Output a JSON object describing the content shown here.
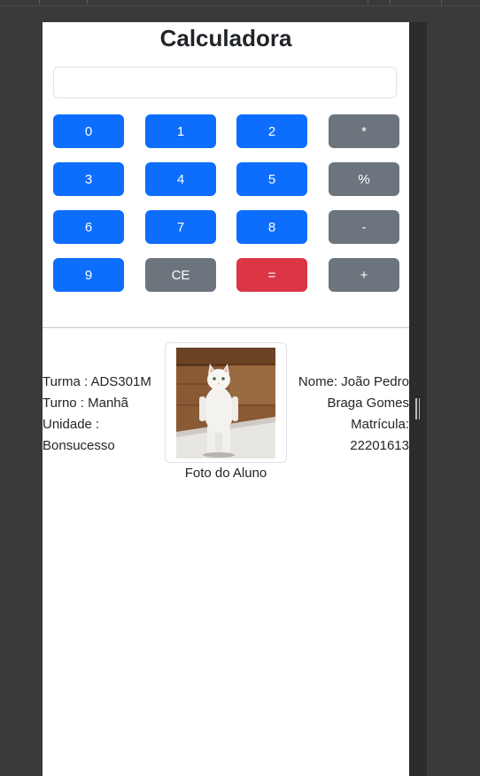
{
  "app": {
    "title": "Calculadora"
  },
  "display": {
    "value": "",
    "placeholder": ""
  },
  "keypad": [
    {
      "label": "0",
      "variant": "primary"
    },
    {
      "label": "1",
      "variant": "primary"
    },
    {
      "label": "2",
      "variant": "primary"
    },
    {
      "label": "*",
      "variant": "secondary"
    },
    {
      "label": "3",
      "variant": "primary"
    },
    {
      "label": "4",
      "variant": "primary"
    },
    {
      "label": "5",
      "variant": "primary"
    },
    {
      "label": "%",
      "variant": "secondary"
    },
    {
      "label": "6",
      "variant": "primary"
    },
    {
      "label": "7",
      "variant": "primary"
    },
    {
      "label": "8",
      "variant": "primary"
    },
    {
      "label": "-",
      "variant": "secondary"
    },
    {
      "label": "9",
      "variant": "primary"
    },
    {
      "label": "CE",
      "variant": "secondary"
    },
    {
      "label": "=",
      "variant": "danger"
    },
    {
      "label": "+",
      "variant": "secondary"
    }
  ],
  "student": {
    "turma_line": "Turma : ADS301M",
    "turno_line": "Turno : Manhã",
    "unidade_line1": "Unidade :",
    "unidade_line2": "Bonsucesso",
    "nome_line1": "Nome: João Pedro",
    "nome_line2": "Braga Gomes",
    "matricula_line1": "Matrícula:",
    "matricula_line2": "22201613",
    "photo_caption": "Foto do Aluno",
    "photo_icon": "student-photo-cat"
  },
  "colors": {
    "primary": "#0d6efd",
    "secondary": "#6c757d",
    "danger": "#dc3545",
    "background": "#3a3a3a",
    "page": "#ffffff"
  }
}
